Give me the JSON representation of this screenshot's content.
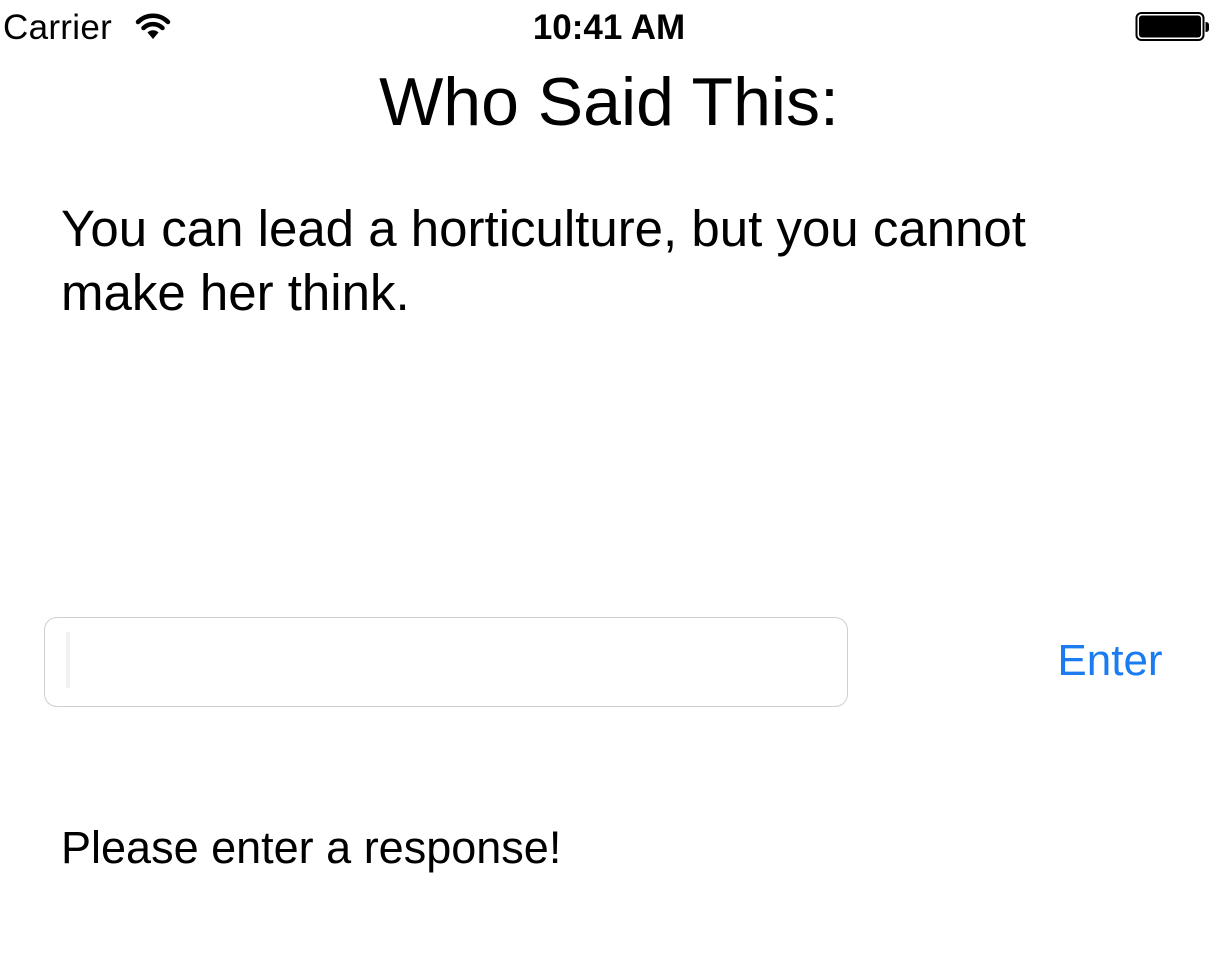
{
  "status_bar": {
    "carrier": "Carrier",
    "time": "10:41 AM",
    "wifi_icon": "wifi-icon",
    "battery_icon": "battery-icon"
  },
  "main": {
    "title": "Who Said This:",
    "quote": "You can lead a horticulture, but you cannot make her think.",
    "answer_input": {
      "value": "",
      "placeholder": ""
    },
    "enter_label": "Enter",
    "feedback": "Please enter a response!"
  },
  "colors": {
    "background": "#ffffff",
    "text": "#000000",
    "accent": "#1a7cf0",
    "input_border": "#cfcfcf"
  }
}
